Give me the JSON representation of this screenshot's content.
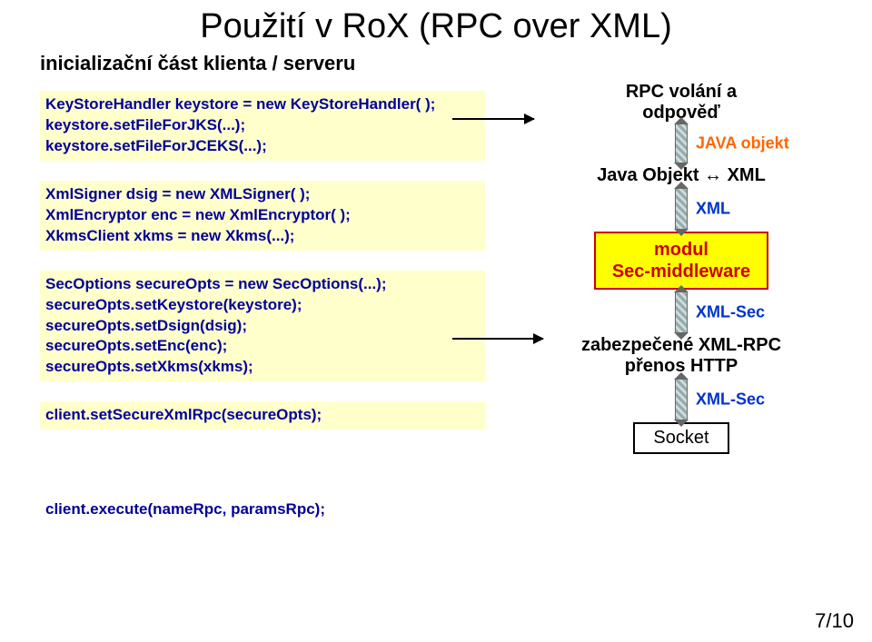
{
  "title": "Použití v RoX (RPC over XML)",
  "subtitle": "inicializační část klienta / serveru",
  "code": {
    "block1": [
      "KeyStoreHandler keystore = new KeyStoreHandler( );",
      "keystore.setFileForJKS(...);",
      "keystore.setFileForJCEKS(...);"
    ],
    "block2": [
      "XmlSigner dsig = new XMLSigner( );",
      "XmlEncryptor enc = new XmlEncryptor( );",
      "XkmsClient xkms = new Xkms(...);"
    ],
    "block3": [
      "SecOptions secureOpts = new SecOptions(...);",
      "secureOpts.setKeystore(keystore);",
      "secureOpts.setDsign(dsig);",
      "secureOpts.setEnc(enc);",
      "secureOpts.setXkms(xkms);"
    ],
    "block4": [
      "client.setSecureXmlRpc(secureOpts);"
    ],
    "exec": "client.execute(nameRpc, paramsRpc);"
  },
  "right": {
    "rpc_line1": "RPC volání a",
    "rpc_line2": "odpověď",
    "java_objekt": "JAVA objekt",
    "java_obj_xml": "Java Objekt ↔ XML",
    "xml": "XML",
    "modul_line1": "modul",
    "modul_line2": "Sec-middleware",
    "xml_sec": "XML-Sec",
    "zab_line1": "zabezpečené XML-RPC",
    "zab_line2": "přenos HTTP",
    "xml_sec2": "XML-Sec",
    "socket": "Socket"
  },
  "page": "7/10"
}
